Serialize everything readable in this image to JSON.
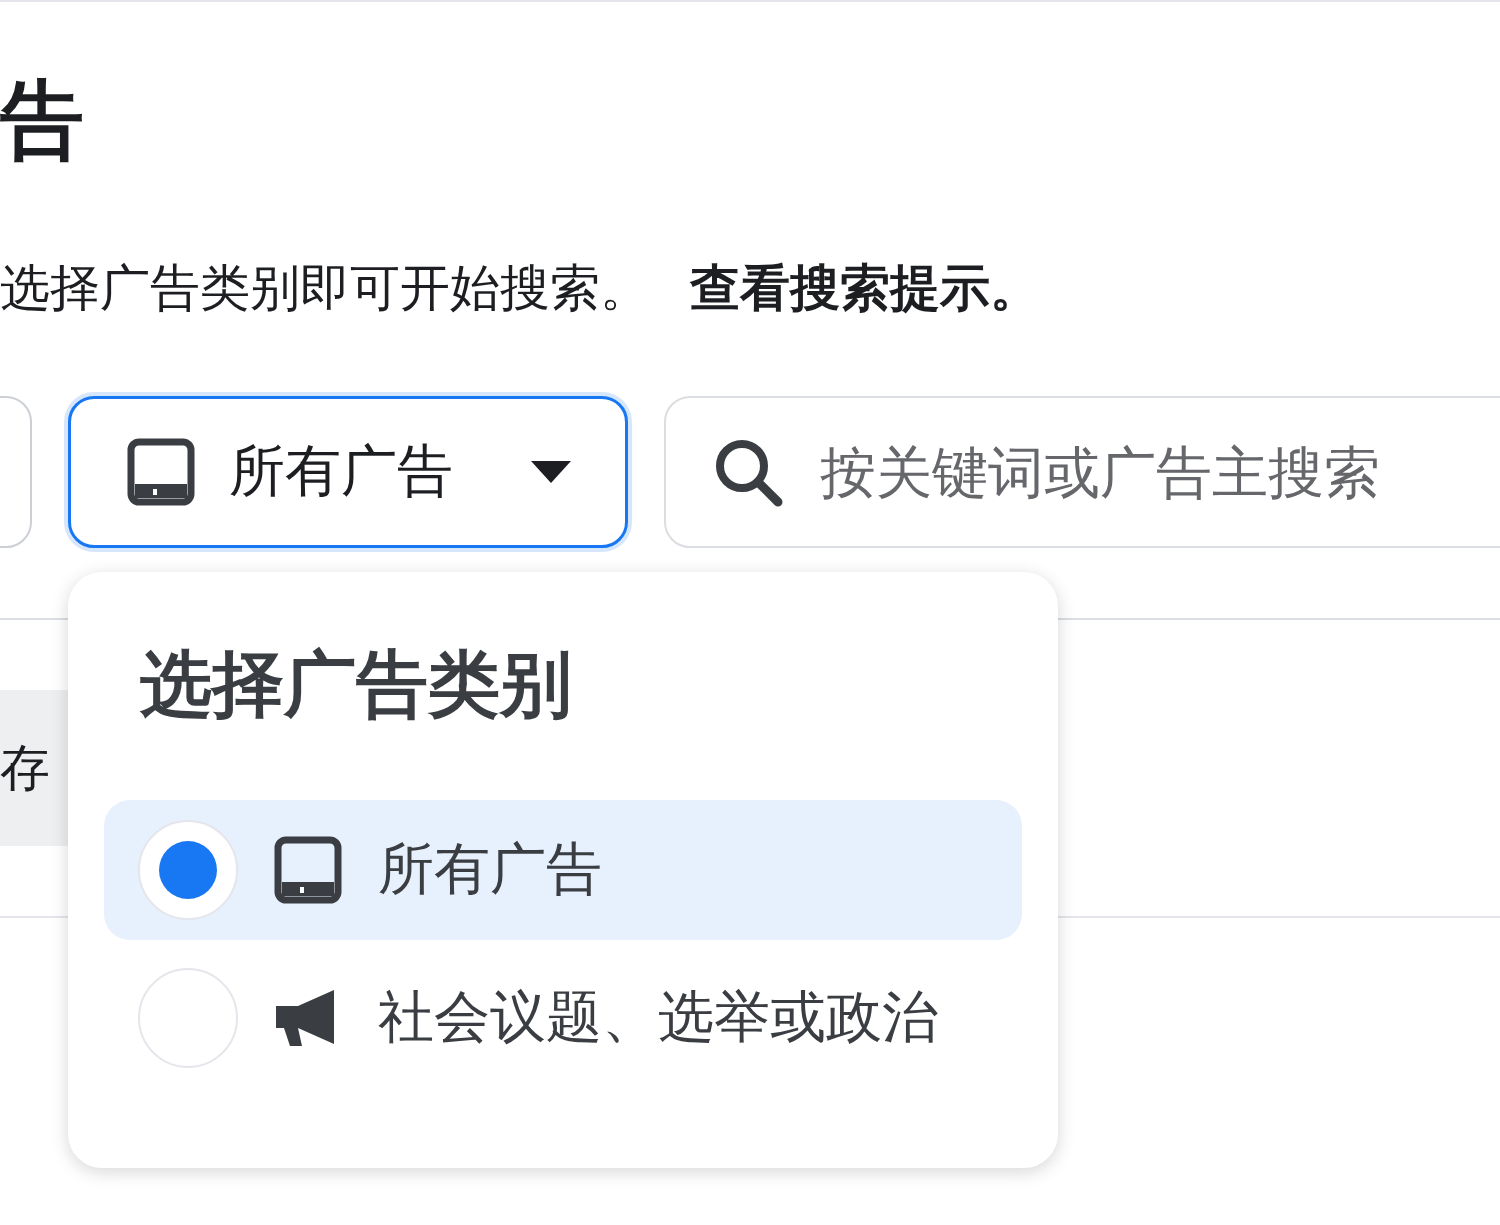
{
  "heading": "告",
  "intro": {
    "text": "选择广告类别即可开始搜索。",
    "link": "查看搜索提示。"
  },
  "category_dropdown": {
    "value": "所有广告",
    "expanded": true
  },
  "search": {
    "placeholder": "按关键词或广告主搜索"
  },
  "saved_button": {
    "label": "存"
  },
  "category_menu": {
    "title": "选择广告类别",
    "options": [
      {
        "label": "所有广告",
        "kind": "all",
        "selected": true
      },
      {
        "label": "社会议题、选举或政治",
        "kind": "political",
        "selected": false
      }
    ]
  }
}
